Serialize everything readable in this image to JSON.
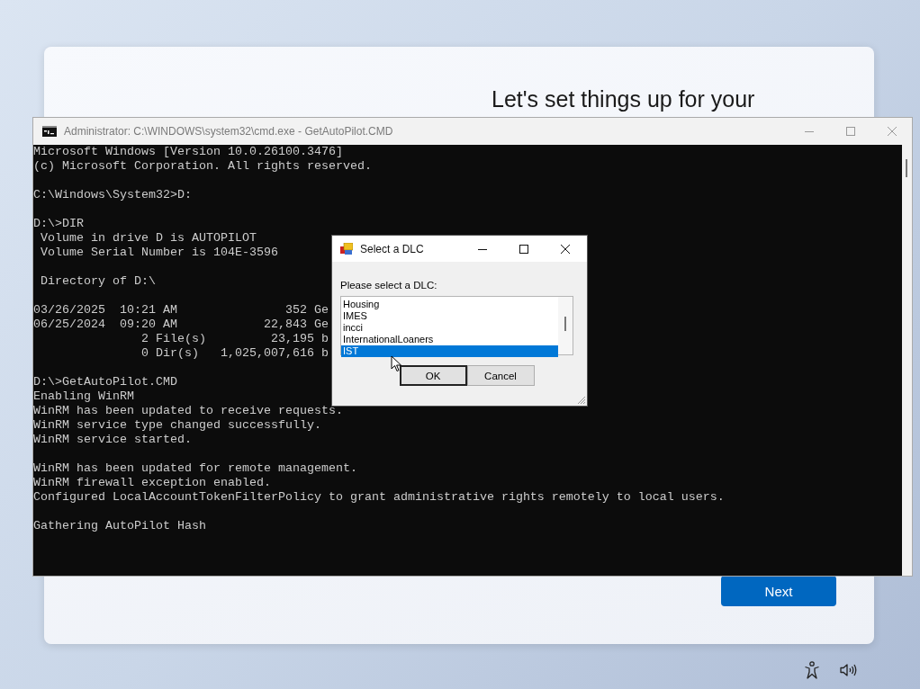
{
  "setup": {
    "heading": "Let's set things up for your",
    "next_button": "Next"
  },
  "console_window": {
    "title": "Administrator: C:\\WINDOWS\\system32\\cmd.exe - GetAutoPilot.CMD",
    "blocks": [
      [
        "Microsoft Windows [Version 10.0.26100.3476]",
        "(c) Microsoft Corporation. All rights reserved."
      ],
      [
        "C:\\Windows\\System32>D:"
      ],
      [
        "D:\\>DIR",
        " Volume in drive D is AUTOPILOT",
        " Volume Serial Number is 104E-3596"
      ],
      [
        " Directory of D:\\"
      ],
      [
        "03/26/2025  10:21 AM               352 Ge",
        "06/25/2024  09:20 AM            22,843 Ge",
        "               2 File(s)         23,195 b",
        "               0 Dir(s)   1,025,007,616 b"
      ],
      [
        "D:\\>GetAutoPilot.CMD",
        "Enabling WinRM",
        "WinRM has been updated to receive requests.",
        "WinRM service type changed successfully.",
        "WinRM service started."
      ],
      [
        "WinRM has been updated for remote management.",
        "WinRM firewall exception enabled.",
        "Configured LocalAccountTokenFilterPolicy to grant administrative rights remotely to local users."
      ],
      [
        "Gathering AutoPilot Hash"
      ]
    ]
  },
  "dialog": {
    "title": "Select a DLC",
    "prompt": "Please select a DLC:",
    "items": [
      {
        "label": "Housing",
        "selected": false
      },
      {
        "label": "IMES",
        "selected": false
      },
      {
        "label": "incci",
        "selected": false
      },
      {
        "label": "InternationalLoaners",
        "selected": false
      },
      {
        "label": "IST",
        "selected": true
      }
    ],
    "buttons": [
      {
        "label": "OK",
        "default": true
      },
      {
        "label": "Cancel",
        "default": false
      }
    ]
  }
}
